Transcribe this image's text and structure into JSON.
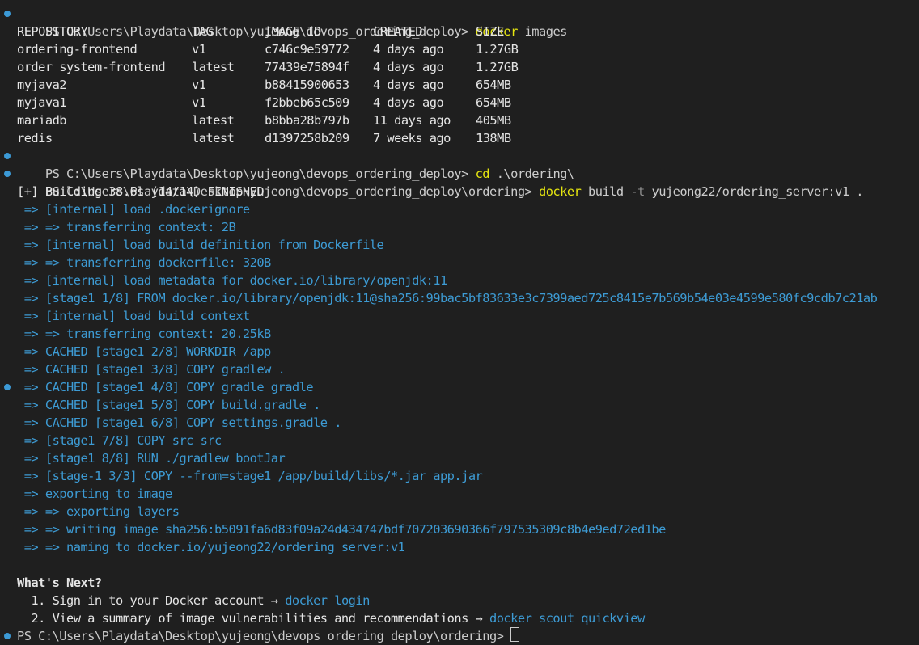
{
  "prompt_path": "PS C:\\Users\\Playdata\\Desktop\\yujeong\\devops_ordering_deploy>",
  "prompt_path_ordering": "PS C:\\Users\\Playdata\\Desktop\\yujeong\\devops_ordering_deploy\\ordering>",
  "cmd1": {
    "name": "docker",
    "args": "images"
  },
  "images_table": {
    "headers": [
      "REPOSITORY",
      "TAG",
      "IMAGE ID",
      "CREATED",
      "SIZE"
    ],
    "rows": [
      [
        "ordering-frontend",
        "v1",
        "c746c9e59772",
        "4 days ago",
        "1.27GB"
      ],
      [
        "order_system-frontend",
        "latest",
        "77439e75894f",
        "4 days ago",
        "1.27GB"
      ],
      [
        "myjava2",
        "v1",
        "b88415900653",
        "4 days ago",
        "654MB"
      ],
      [
        "myjava1",
        "v1",
        "f2bbeb65c509",
        "4 days ago",
        "654MB"
      ],
      [
        "mariadb",
        "latest",
        "b8bba28b797b",
        "11 days ago",
        "405MB"
      ],
      [
        "redis",
        "latest",
        "d1397258b209",
        "7 weeks ago",
        "138MB"
      ]
    ]
  },
  "cmd2": {
    "name": "cd",
    "args": ".\\ordering\\"
  },
  "cmd3": {
    "name": "docker",
    "args_pre": "build",
    "flag": "-t",
    "args_post": "yujeong22/ordering_server:v1 ."
  },
  "build_header": "[+] Building 38.6s (14/14) FINISHED",
  "build_steps": [
    " => [internal] load .dockerignore",
    " => => transferring context: 2B",
    " => [internal] load build definition from Dockerfile",
    " => => transferring dockerfile: 320B",
    " => [internal] load metadata for docker.io/library/openjdk:11",
    " => [stage1 1/8] FROM docker.io/library/openjdk:11@sha256:99bac5bf83633e3c7399aed725c8415e7b569b54e03e4599e580fc9cdb7c21ab",
    " => [internal] load build context",
    " => => transferring context: 20.25kB",
    " => CACHED [stage1 2/8] WORKDIR /app",
    " => CACHED [stage1 3/8] COPY gradlew .",
    " => CACHED [stage1 4/8] COPY gradle gradle",
    " => CACHED [stage1 5/8] COPY build.gradle .",
    " => CACHED [stage1 6/8] COPY settings.gradle .",
    " => [stage1 7/8] COPY src src",
    " => [stage1 8/8] RUN ./gradlew bootJar",
    " => [stage-1 3/3] COPY --from=stage1 /app/build/libs/*.jar app.jar",
    " => exporting to image",
    " => => exporting layers",
    " => => writing image sha256:b5091fa6d83f09a24d434747bdf707203690366f797535309c8b4e9ed72ed1be",
    " => => naming to docker.io/yujeong22/ordering_server:v1"
  ],
  "whats_next": {
    "title": "What's Next?",
    "item1_text": "  1. Sign in to your Docker account → ",
    "item1_link": "docker login",
    "item2_text": "  2. View a summary of image vulnerabilities and recommendations → ",
    "item2_link": "docker scout quickview"
  },
  "partial_prompt": "PS C:\\Users\\Playdata\\Desktop\\yujeong\\devops_ordering_deploy\\ordering>",
  "colors": {
    "background": "#1f1f1f",
    "text": "#cccccc",
    "command": "#e5e510",
    "build_output": "#3d9bd4",
    "dot": "#3c9ad6"
  }
}
